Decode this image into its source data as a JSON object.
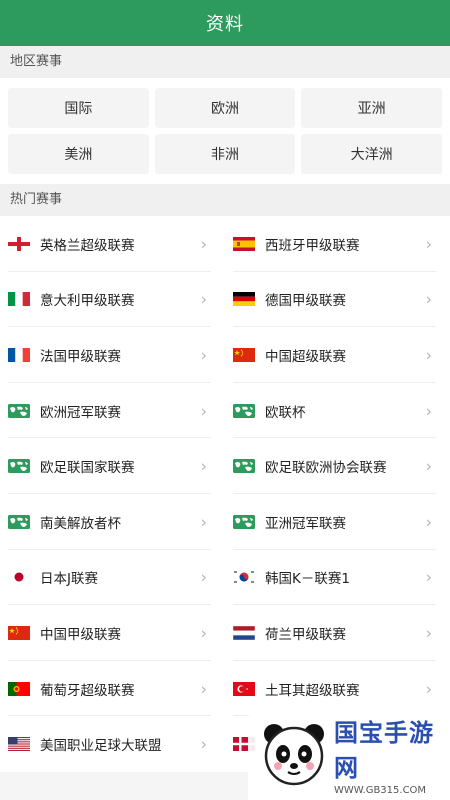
{
  "header": {
    "title": "资料"
  },
  "sections": {
    "region_title": "地区赛事",
    "hot_title": "热门赛事"
  },
  "regions": [
    "国际",
    "欧洲",
    "亚洲",
    "美洲",
    "非洲",
    "大洋洲"
  ],
  "leagues": [
    {
      "name": "英格兰超级联赛",
      "flag": "england"
    },
    {
      "name": "西班牙甲级联赛",
      "flag": "spain"
    },
    {
      "name": "意大利甲级联赛",
      "flag": "italy"
    },
    {
      "name": "德国甲级联赛",
      "flag": "germany"
    },
    {
      "name": "法国甲级联赛",
      "flag": "france"
    },
    {
      "name": "中国超级联赛",
      "flag": "china"
    },
    {
      "name": "欧洲冠军联赛",
      "flag": "world"
    },
    {
      "name": "欧联杯",
      "flag": "world"
    },
    {
      "name": "欧足联国家联赛",
      "flag": "world"
    },
    {
      "name": "欧足联欧洲协会联赛",
      "flag": "world"
    },
    {
      "name": "南美解放者杯",
      "flag": "world"
    },
    {
      "name": "亚洲冠军联赛",
      "flag": "world"
    },
    {
      "name": "日本J联赛",
      "flag": "japan"
    },
    {
      "name": "韩国K－联赛1",
      "flag": "korea"
    },
    {
      "name": "中国甲级联赛",
      "flag": "china"
    },
    {
      "name": "荷兰甲级联赛",
      "flag": "netherlands"
    },
    {
      "name": "葡萄牙超级联赛",
      "flag": "portugal"
    },
    {
      "name": "土耳其超级联赛",
      "flag": "turkey"
    },
    {
      "name": "美国职业足球大联盟",
      "flag": "usa"
    },
    {
      "name": "",
      "flag": "denmark"
    }
  ],
  "watermark": {
    "main": "国宝手游网",
    "sub": "WWW.GB315.COM"
  },
  "colors": {
    "accent": "#2e9b5e"
  }
}
